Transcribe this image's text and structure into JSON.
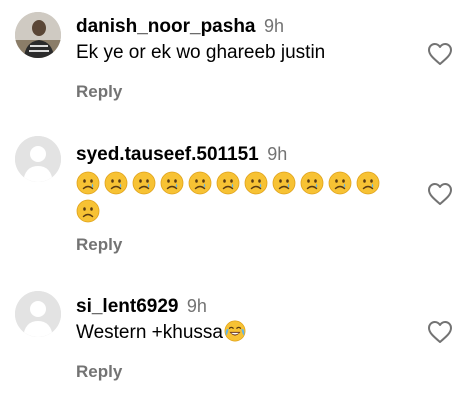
{
  "comments": [
    {
      "username": "danish_noor_pasha",
      "time": "9h",
      "text": "Ek ye or ek wo ghareeb justin",
      "reply_label": "Reply",
      "avatar": "user-photo",
      "like_icon": "heart-outline-icon"
    },
    {
      "username": "syed.tauseef.501151",
      "time": "9h",
      "emoji": [
        "crying-face-emoji",
        "crying-face-emoji",
        "crying-face-emoji",
        "crying-face-emoji",
        "crying-face-emoji",
        "crying-face-emoji",
        "crying-face-emoji",
        "crying-face-emoji",
        "crying-face-emoji",
        "crying-face-emoji",
        "crying-face-emoji",
        "frowning-face-emoji"
      ],
      "reply_label": "Reply",
      "avatar": "default-avatar",
      "like_icon": "heart-outline-icon"
    },
    {
      "username": "si_lent6929",
      "time": "9h",
      "text": "Western +khussa",
      "text_emoji": "tears-of-joy-emoji",
      "reply_label": "Reply",
      "avatar": "default-avatar",
      "like_icon": "heart-outline-icon"
    }
  ],
  "colors": {
    "secondary_text": "#737373",
    "emoji_yellow": "#f7c234",
    "avatar_placeholder": "#e3e3e3"
  }
}
